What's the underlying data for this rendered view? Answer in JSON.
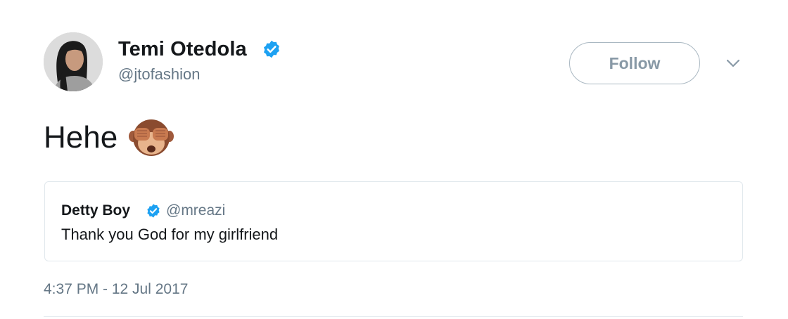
{
  "author": {
    "name": "Temi Otedola",
    "handle": "@jtofashion",
    "verified": true
  },
  "follow_button": {
    "label": "Follow"
  },
  "tweet": {
    "text": "Hehe",
    "emoji": "see-no-evil-monkey"
  },
  "quoted_tweet": {
    "name": "Detty Boy",
    "handle": "@mreazi",
    "verified": true,
    "text": "Thank you God for my girlfriend"
  },
  "timestamp": "4:37 PM - 12 Jul 2017",
  "colors": {
    "verified_blue": "#1da1f2",
    "secondary_text": "#657786",
    "border": "#e1e8ed"
  }
}
